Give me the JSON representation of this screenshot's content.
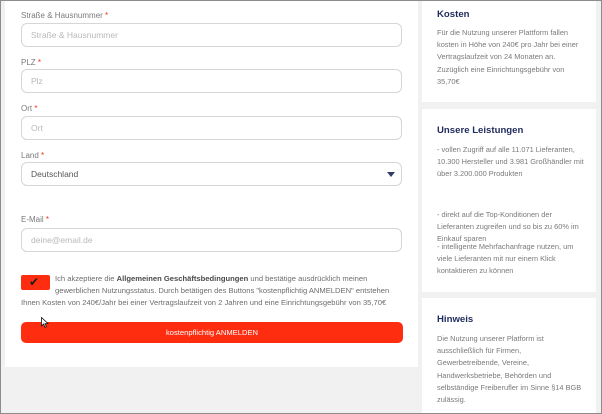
{
  "form": {
    "street": {
      "label": "Straße & Hausnummer",
      "required": "*",
      "placeholder": "Straße & Hausnummer"
    },
    "plz": {
      "label": "PLZ",
      "required": "*",
      "placeholder": "Plz"
    },
    "ort": {
      "label": "Ort",
      "required": "*",
      "placeholder": "Ort"
    },
    "land": {
      "label": "Land",
      "required": "*",
      "value": "Deutschland"
    },
    "email": {
      "label": "E-Mail",
      "required": "*",
      "placeholder": "deine@email.de"
    },
    "terms": {
      "prefix": "Ich akzeptiere die ",
      "link": "Allgemeinen Geschäftsbedingungen",
      "suffix": " und bestätige ausdrücklich meinen gewerblichen Nutzungsstatus. Durch betätigen des Buttons \"kostenpflichtig ANMELDEN\" entstehen",
      "line2": "Ihnen Kosten von 240€/Jahr bei einer Vertragslaufzeit von 2 Jahren und eine Einrichtungsgebühr von 35,70€"
    },
    "submit_label": "kostenpflichtig ANMELDEN"
  },
  "sidebar": {
    "kosten": {
      "title": "Kosten",
      "text": "Für die Nutzung unserer Plattform fallen kosten in Höhe von 240€ pro Jahr bei einer Vertragslaufzeit von 24 Monaten an. Zuzüglich eine Einrichtungsgebühr von 35,70€"
    },
    "leistungen": {
      "title": "Unsere Leistungen",
      "items": [
        "- vollen Zugriff auf alle 11.071 Lieferanten, 10.300 Hersteller und 3.981 Großhändler mit über 3.200.000 Produkten",
        "- direkt auf die Top-Konditionen der Lieferanten zugreifen und so bis zu 60% im Einkauf sparen",
        "- intelligente Mehrfachanfrage nutzen, um viele Lieferanten mit nur einem Klick kontaktieren zu können"
      ]
    },
    "hinweis": {
      "title": "Hinweis",
      "text": "Die Nutzung unserer Platform ist ausschließlich für Firmen, Gewerbetreibende, Vereine, Handwerksbetriebe, Behörden und selbständige Freiberufler im Sinne §14 BGB zulässig."
    }
  },
  "colors": {
    "accent": "#ff2d10",
    "heading": "#1f2b5c"
  }
}
